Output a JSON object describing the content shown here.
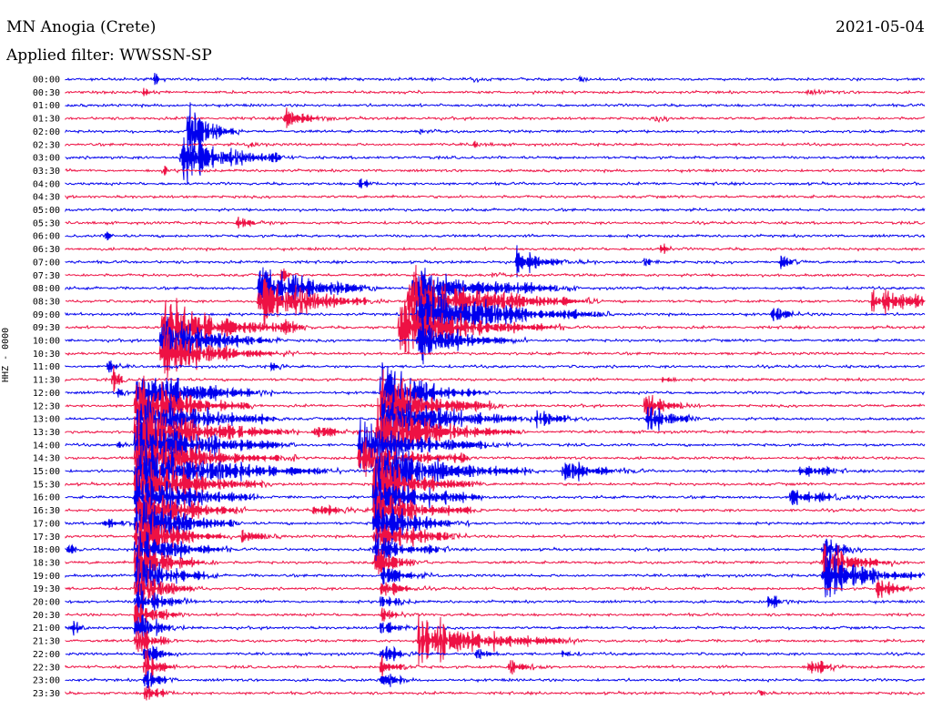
{
  "header": {
    "station": "MN Anogia (Crete)",
    "date": "2021-05-04",
    "filter": "Applied filter: WWSSN-SP"
  },
  "chart_data": {
    "type": "line",
    "ylabel": "HHZ - 0000",
    "y_tick_labels": [
      "00:00",
      "00:30",
      "01:00",
      "01:30",
      "02:00",
      "02:30",
      "03:00",
      "03:30",
      "04:00",
      "04:30",
      "05:00",
      "05:30",
      "06:00",
      "06:30",
      "07:00",
      "07:30",
      "08:00",
      "08:30",
      "09:00",
      "09:30",
      "10:00",
      "10:30",
      "11:00",
      "11:30",
      "12:00",
      "12:30",
      "13:00",
      "13:30",
      "14:00",
      "14:30",
      "15:00",
      "15:30",
      "16:00",
      "16:30",
      "17:00",
      "17:30",
      "18:00",
      "18:30",
      "19:00",
      "19:30",
      "20:00",
      "20:30",
      "21:00",
      "21:30",
      "22:00",
      "22:30",
      "23:00",
      "23:30"
    ],
    "series_colors": [
      "#0000ee",
      "#ee1144"
    ],
    "grid": false
  }
}
